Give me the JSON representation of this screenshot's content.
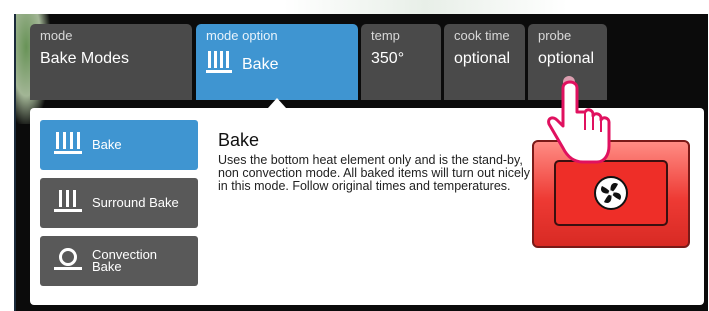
{
  "tabs": [
    {
      "label": "mode",
      "value": "Bake Modes"
    },
    {
      "label": "mode option",
      "value": "Bake"
    },
    {
      "label": "temp",
      "value": "350°"
    },
    {
      "label": "cook time",
      "value": "optional"
    },
    {
      "label": "probe",
      "value": "optional"
    }
  ],
  "modes": [
    {
      "label": "Bake",
      "icon": "bake-elements-icon",
      "selected": true
    },
    {
      "label": "Surround Bake",
      "icon": "surround-bake-icon",
      "selected": false
    },
    {
      "label": "Convection Bake",
      "icon": "convection-bake-icon",
      "selected": false
    }
  ],
  "description": {
    "title": "Bake",
    "body": "Uses the bottom heat element only and is the stand-by, non convection mode. All baked items will turn out nicely in this mode. Follow original times and temperatures."
  },
  "oven_icon": "oven-fan-icon",
  "pointer_icon": "pointing-hand-icon",
  "colors": {
    "active_blue": "#3f95d1",
    "tab_gray": "#4a4a4a",
    "button_gray": "#595959",
    "oven_red": "#ee3a34"
  }
}
